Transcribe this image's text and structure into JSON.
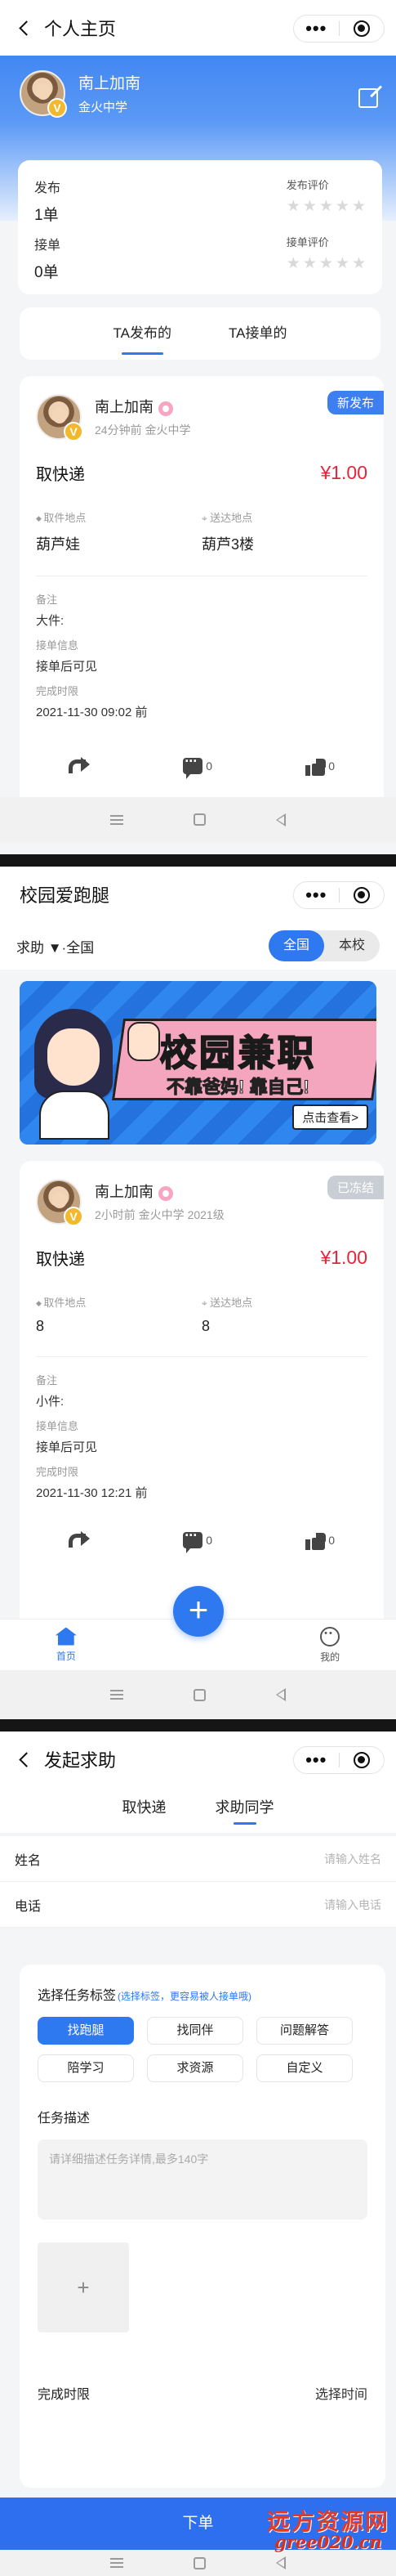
{
  "screen1": {
    "nav_title": "个人主页",
    "capsule": {
      "more": "•••"
    },
    "profile": {
      "name": "南上加南",
      "school": "金火中学",
      "badge": "V"
    },
    "stats": {
      "publish_label": "发布",
      "publish_value": "1单",
      "accept_label": "接单",
      "accept_value": "0单",
      "publish_rating_label": "发布评价",
      "accept_rating_label": "接单评价",
      "star": "★"
    },
    "tabs": [
      "TA发布的",
      "TA接单的"
    ],
    "order": {
      "user": "南上加南",
      "meta": "24分钟前 金火中学",
      "status": "新发布",
      "status_color": "#3d7ff0",
      "title": "取快递",
      "price": "¥1.00",
      "from_label": "取件地点",
      "from_value": "葫芦娃",
      "to_label": "送达地点",
      "to_value": "葫芦3楼",
      "note_label": "备注",
      "note_value": "大件:",
      "info_label": "接单信息",
      "info_value": "接单后可见",
      "deadline_label": "完成时限",
      "deadline_value": "2021-11-30 09:02 前",
      "comment_count": "0",
      "like_count": "0"
    }
  },
  "screen2": {
    "nav_title": "校园爱跑腿",
    "filter_text": "求助 ▼·全国",
    "segment": [
      "全国",
      "本校"
    ],
    "banner": {
      "title": "校园兼职",
      "subtitle": "不靠爸妈!  靠自己!",
      "button": "点击查看>"
    },
    "order": {
      "user": "南上加南",
      "meta": "2小时前 金火中学 2021级",
      "status": "已冻结",
      "status_color": "#c9cdd4",
      "title": "取快递",
      "price": "¥1.00",
      "from_label": "取件地点",
      "from_value": "8",
      "to_label": "送达地点",
      "to_value": "8",
      "note_label": "备注",
      "note_value": "小件:",
      "info_label": "接单信息",
      "info_value": "接单后可见",
      "deadline_label": "完成时限",
      "deadline_value": "2021-11-30 12:21 前",
      "comment_count": "0",
      "like_count": "0"
    },
    "tabbar": {
      "home": "首页",
      "add": "+",
      "me": "我的"
    }
  },
  "screen3": {
    "nav_title": "发起求助",
    "tabs": [
      "取快递",
      "求助同学"
    ],
    "name_label": "姓名",
    "name_placeholder": "请输入姓名",
    "phone_label": "电话",
    "phone_placeholder": "请输入电话",
    "tag_section": "选择任务标签",
    "tag_hint": "(选择标签，更容易被人接单哦)",
    "tags": [
      "找跑腿",
      "找同伴",
      "问题解答",
      "陪学习",
      "求资源",
      "自定义"
    ],
    "desc_label": "任务描述",
    "desc_placeholder": "请详细描述任务详情,最多140字",
    "upload_plus": "+",
    "deadline_label": "完成时限",
    "deadline_pick": "选择时间",
    "submit": "下单",
    "watermark_1": "远方资源网",
    "watermark_2": "gree020.cn"
  }
}
